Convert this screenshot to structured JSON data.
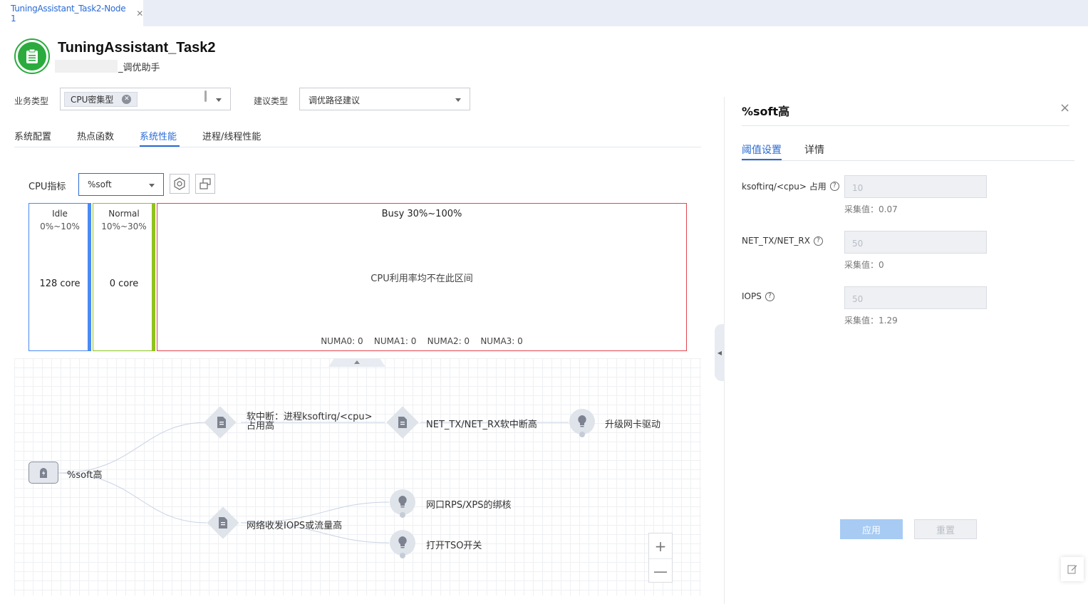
{
  "window": {
    "tab_label": "TuningAssistant_Task2-Node 1"
  },
  "header": {
    "title": "TuningAssistant_Task2",
    "subtitle": "_调优助手"
  },
  "filters": {
    "business_type_label": "业务类型",
    "business_type_chip": "CPU密集型",
    "advice_type_label": "建议类型",
    "advice_type_value": "调优路径建议"
  },
  "tabs": [
    {
      "label": "系统配置"
    },
    {
      "label": "热点函数"
    },
    {
      "label": "系统性能"
    },
    {
      "label": "进程/线程性能"
    }
  ],
  "cpu_metric": {
    "label": "CPU指标",
    "value": "%soft"
  },
  "ranges": {
    "idle": {
      "name": "Idle",
      "span": "0%~10%",
      "cores": "128 core",
      "color": "#4a8af4"
    },
    "normal": {
      "name": "Normal",
      "span": "10%~30%",
      "cores": "0 core",
      "color": "#8fc31f"
    },
    "busy": {
      "title": "Busy 30%~100%",
      "message": "CPU利用率均不在此区间",
      "numa": "NUMA0: 0    NUMA1: 0    NUMA2: 0    NUMA3: 0",
      "color": "#e0464d"
    }
  },
  "graph": {
    "root": "%soft高",
    "n1": "软中断：进程ksoftirq/<cpu>",
    "n1b": "占用高",
    "n2": "NET_TX/NET_RX软中断高",
    "n3": "升级网卡驱动",
    "n4": "网络收发IOPS或流量高",
    "n5": "网口RPS/XPS的绑核",
    "n6": "打开TSO开关"
  },
  "zoom": {
    "in": "+",
    "out": "—"
  },
  "panel": {
    "title": "%soft高",
    "close": "×",
    "tab_threshold": "阈值设置",
    "tab_detail": "详情",
    "fields": [
      {
        "label": "ksoftirq/<cpu> 占用",
        "value": "10",
        "hint": "采集值：0.07"
      },
      {
        "label": "NET_TX/NET_RX",
        "value": "50",
        "hint": "采集值：0"
      },
      {
        "label": "IOPS",
        "value": "50",
        "hint": "采集值：1.29"
      }
    ],
    "apply": "应用",
    "reset": "重置"
  },
  "colors": {
    "accent": "#2a6bd6",
    "logo": "#2bab3e"
  }
}
